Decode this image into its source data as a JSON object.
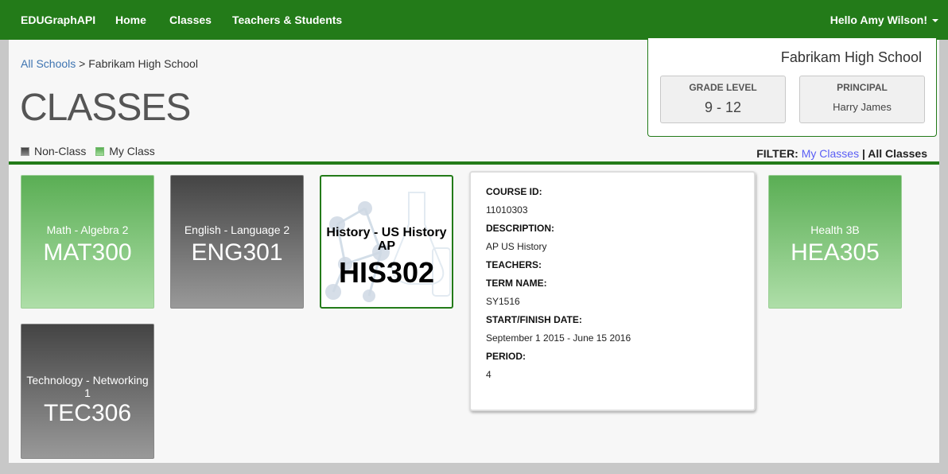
{
  "nav": {
    "brand": "EDUGraphAPI",
    "home": "Home",
    "classes": "Classes",
    "teachers_students": "Teachers & Students",
    "user_greeting": "Hello Amy Wilson!"
  },
  "breadcrumb": {
    "root": "All Schools",
    "separator": ">",
    "current": "Fabrikam High School"
  },
  "page_title": "CLASSES",
  "legend": {
    "non_class": "Non-Class",
    "my_class": "My Class"
  },
  "filter": {
    "label": "FILTER:",
    "my_classes": "My Classes",
    "separator": "|",
    "all_classes": "All Classes"
  },
  "school": {
    "name": "Fabrikam High School",
    "grade_level_label": "GRADE LEVEL",
    "grade_level": "9 - 12",
    "principal_label": "PRINCIPAL",
    "principal": "Harry James"
  },
  "classes": [
    {
      "name": "Math - Algebra 2",
      "code": "MAT300",
      "kind": "my"
    },
    {
      "name": "English - Language 2",
      "code": "ENG301",
      "kind": "non"
    },
    {
      "name": "History - US History AP",
      "code": "HIS302",
      "kind": "selected"
    },
    {
      "name": "Health 3B",
      "code": "HEA305",
      "kind": "my"
    },
    {
      "name": "Technology - Networking 1",
      "code": "TEC306",
      "kind": "non"
    }
  ],
  "detail": {
    "course_id_label": "COURSE ID:",
    "course_id": "11010303",
    "description_label": "DESCRIPTION:",
    "description": "AP US History",
    "teachers_label": "TEACHERS:",
    "term_name_label": "TERM NAME:",
    "term_name": "SY1516",
    "start_finish_label": "START/FINISH DATE:",
    "start_finish": "September 1 2015 - June 15 2016",
    "period_label": "PERIOD:",
    "period": "4"
  },
  "colors": {
    "brand_green": "#237b19",
    "link_blue": "#3e74b1",
    "filter_link": "#5a5ef5"
  }
}
